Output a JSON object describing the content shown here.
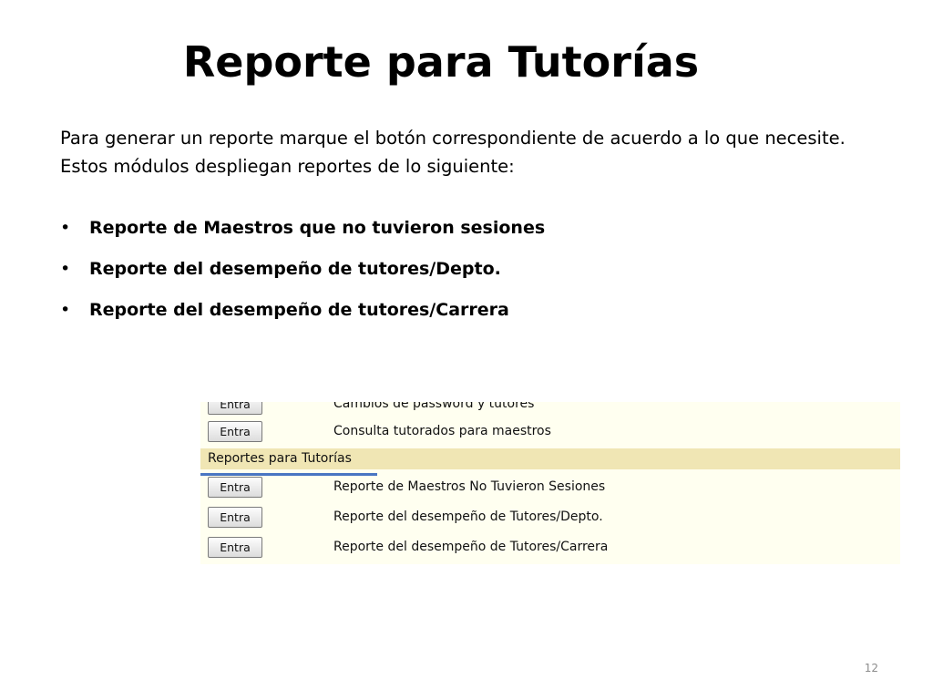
{
  "slide": {
    "title": "Reporte para Tutorías",
    "intro": "Para generar un reporte marque el botón correspondiente de acuerdo a lo que necesite. Estos módulos despliegan reportes de lo siguiente:",
    "bullets": [
      "Reporte de Maestros que no tuvieron sesiones",
      "Reporte del desempeño de tutores/Depto.",
      "Reporte del desempeño de tutores/Carrera"
    ],
    "bullet_symbol": "•",
    "page_number": "12"
  },
  "screenshot": {
    "rows_top": [
      {
        "button": "Entra",
        "label": "Cambios de password y tutores"
      },
      {
        "button": "Entra",
        "label": "Consulta tutorados para maestros"
      }
    ],
    "section": "Reportes para Tutorías",
    "rows_bottom": [
      {
        "button": "Entra",
        "label": "Reporte de Maestros No Tuvieron Sesiones"
      },
      {
        "button": "Entra",
        "label": "Reporte del desempeño de Tutores/Depto."
      },
      {
        "button": "Entra",
        "label": "Reporte del desempeño de Tutores/Carrera"
      }
    ],
    "colors": {
      "background": "#fffff0",
      "section_band": "#f0e6b4",
      "underline": "#4a76c2"
    }
  }
}
